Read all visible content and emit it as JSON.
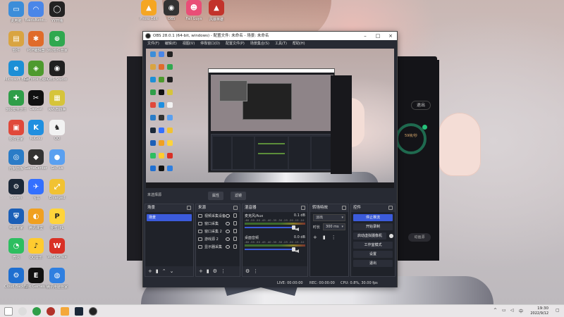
{
  "desktop_icons": [
    {
      "label": "此电脑",
      "color": "#3c8dd9",
      "glyph": "▭"
    },
    {
      "label": "BaiduNetd...",
      "color": "#4a86e8",
      "glyph": "◠"
    },
    {
      "label": "YY开播",
      "color": "#222222",
      "glyph": "◯"
    },
    {
      "label": "软件",
      "color": "#d9a441",
      "glyph": "▤"
    },
    {
      "label": "PDF编辑器",
      "color": "#e06b2a",
      "glyph": "✱"
    },
    {
      "label": "360软件管家",
      "color": "#2fa84f",
      "glyph": "⊕"
    },
    {
      "label": "Microsoft Edge",
      "color": "#1c8fd6",
      "glyph": "e"
    },
    {
      "label": "GeForce Experience",
      "color": "#4e9a2e",
      "glyph": "◈"
    },
    {
      "label": "OBS Studio",
      "color": "#202020",
      "glyph": "◉"
    },
    {
      "label": "360安全卫士",
      "color": "#2f9e48",
      "glyph": "✚"
    },
    {
      "label": "CapCut",
      "color": "#111111",
      "glyph": "✂"
    },
    {
      "label": "RMVB转换",
      "color": "#d6c43a",
      "glyph": "▦"
    },
    {
      "label": "软件管家",
      "color": "#e0483a",
      "glyph": "▣"
    },
    {
      "label": "KuGou",
      "color": "#1f8fe0",
      "glyph": "K"
    },
    {
      "label": "QQ",
      "color": "#f2f2f2",
      "glyph": "♞"
    },
    {
      "label": "控制面板",
      "color": "#2a7cc7",
      "glyph": "◎"
    },
    {
      "label": "GameCenter",
      "color": "#333333",
      "glyph": "◆"
    },
    {
      "label": "GoPlus",
      "color": "#5aa0f0",
      "glyph": "●"
    },
    {
      "label": "Steam",
      "color": "#1b2838",
      "glyph": "⚙"
    },
    {
      "label": "飞书",
      "color": "#3370ff",
      "glyph": "✈"
    },
    {
      "label": "Enlarged",
      "color": "#f1c232",
      "glyph": "⤢"
    },
    {
      "label": "电脑管家",
      "color": "#1b5fb7",
      "glyph": "⛨"
    },
    {
      "label": "腾讯课堂",
      "color": "#f0a020",
      "glyph": "◐"
    },
    {
      "label": "便签 JPL",
      "color": "#ffd43b",
      "glyph": "P"
    },
    {
      "label": "微信",
      "color": "#2dbe60",
      "glyph": "◔"
    },
    {
      "label": "QQ音乐",
      "color": "#ffcb2f",
      "glyph": "♪"
    },
    {
      "label": "WPS Office",
      "color": "#d93025",
      "glyph": "W"
    },
    {
      "label": "Cloud Backup",
      "color": "#1f6fd0",
      "glyph": "⚙"
    },
    {
      "label": "Epic Games Launcher",
      "color": "#111111",
      "glyph": "E"
    },
    {
      "label": "腾讯电脑管家",
      "color": "#2f7fe0",
      "glyph": "◍"
    },
    {
      "label": "Photo Edit",
      "color": "#f5a623",
      "glyph": "▲"
    },
    {
      "label": "OBS",
      "color": "#333333",
      "glyph": "◉"
    },
    {
      "label": "Fall Guys",
      "color": "#e94e77",
      "glyph": "☻"
    },
    {
      "label": "风暴英雄",
      "color": "#c2332b",
      "glyph": "▲"
    }
  ],
  "obs": {
    "title": "OBS 28.0.1 (64-bit, windows) - 配置文件: 未命名 - 场景: 未命名",
    "menu": [
      "文件(F)",
      "编辑(E)",
      "视图(V)",
      "停靠窗口(D)",
      "配置文件(P)",
      "场景集合(S)",
      "工具(T)",
      "帮助(H)"
    ],
    "source_hint": "未选择源",
    "toolbar_buttons": [
      "属性",
      "滤镜"
    ],
    "docks": {
      "scenes": {
        "title": "场景",
        "items": [
          "场景"
        ]
      },
      "sources": {
        "title": "来源",
        "items": [
          "视频采集设备",
          "窗口采集",
          "窗口采集 2",
          "游戏源 2",
          "显示器采集"
        ]
      },
      "mixer": {
        "title": "混音器",
        "channels": [
          {
            "name": "麦克风/Aux",
            "db": "0.1 dB"
          },
          {
            "name": "桌面音频",
            "db": "0.0 dB"
          }
        ],
        "ticks": "-60 -55 -50 -45 -40 -35 -30 -25 -20 -15 -10 -5 0"
      },
      "transitions": {
        "title": "转场特效",
        "type": "淡出",
        "duration_label": "时长",
        "duration": "300 ms"
      },
      "controls": {
        "title": "控件",
        "buttons": [
          "停止推流",
          "开始录制",
          "启动虚拟摄像机",
          "工作室模式",
          "设置",
          "退出"
        ]
      }
    },
    "status": {
      "live": "LIVE: 00:00:00",
      "rec": "REC: 00:00:00",
      "cpu": "CPU: 0.8%, 30.00 fps"
    }
  },
  "bg_app": {
    "chip": "退出",
    "ring_text": "59帧/秒",
    "button": "动画源"
  },
  "taskbar": {
    "time": "19:30",
    "date": "2022/9/12"
  }
}
